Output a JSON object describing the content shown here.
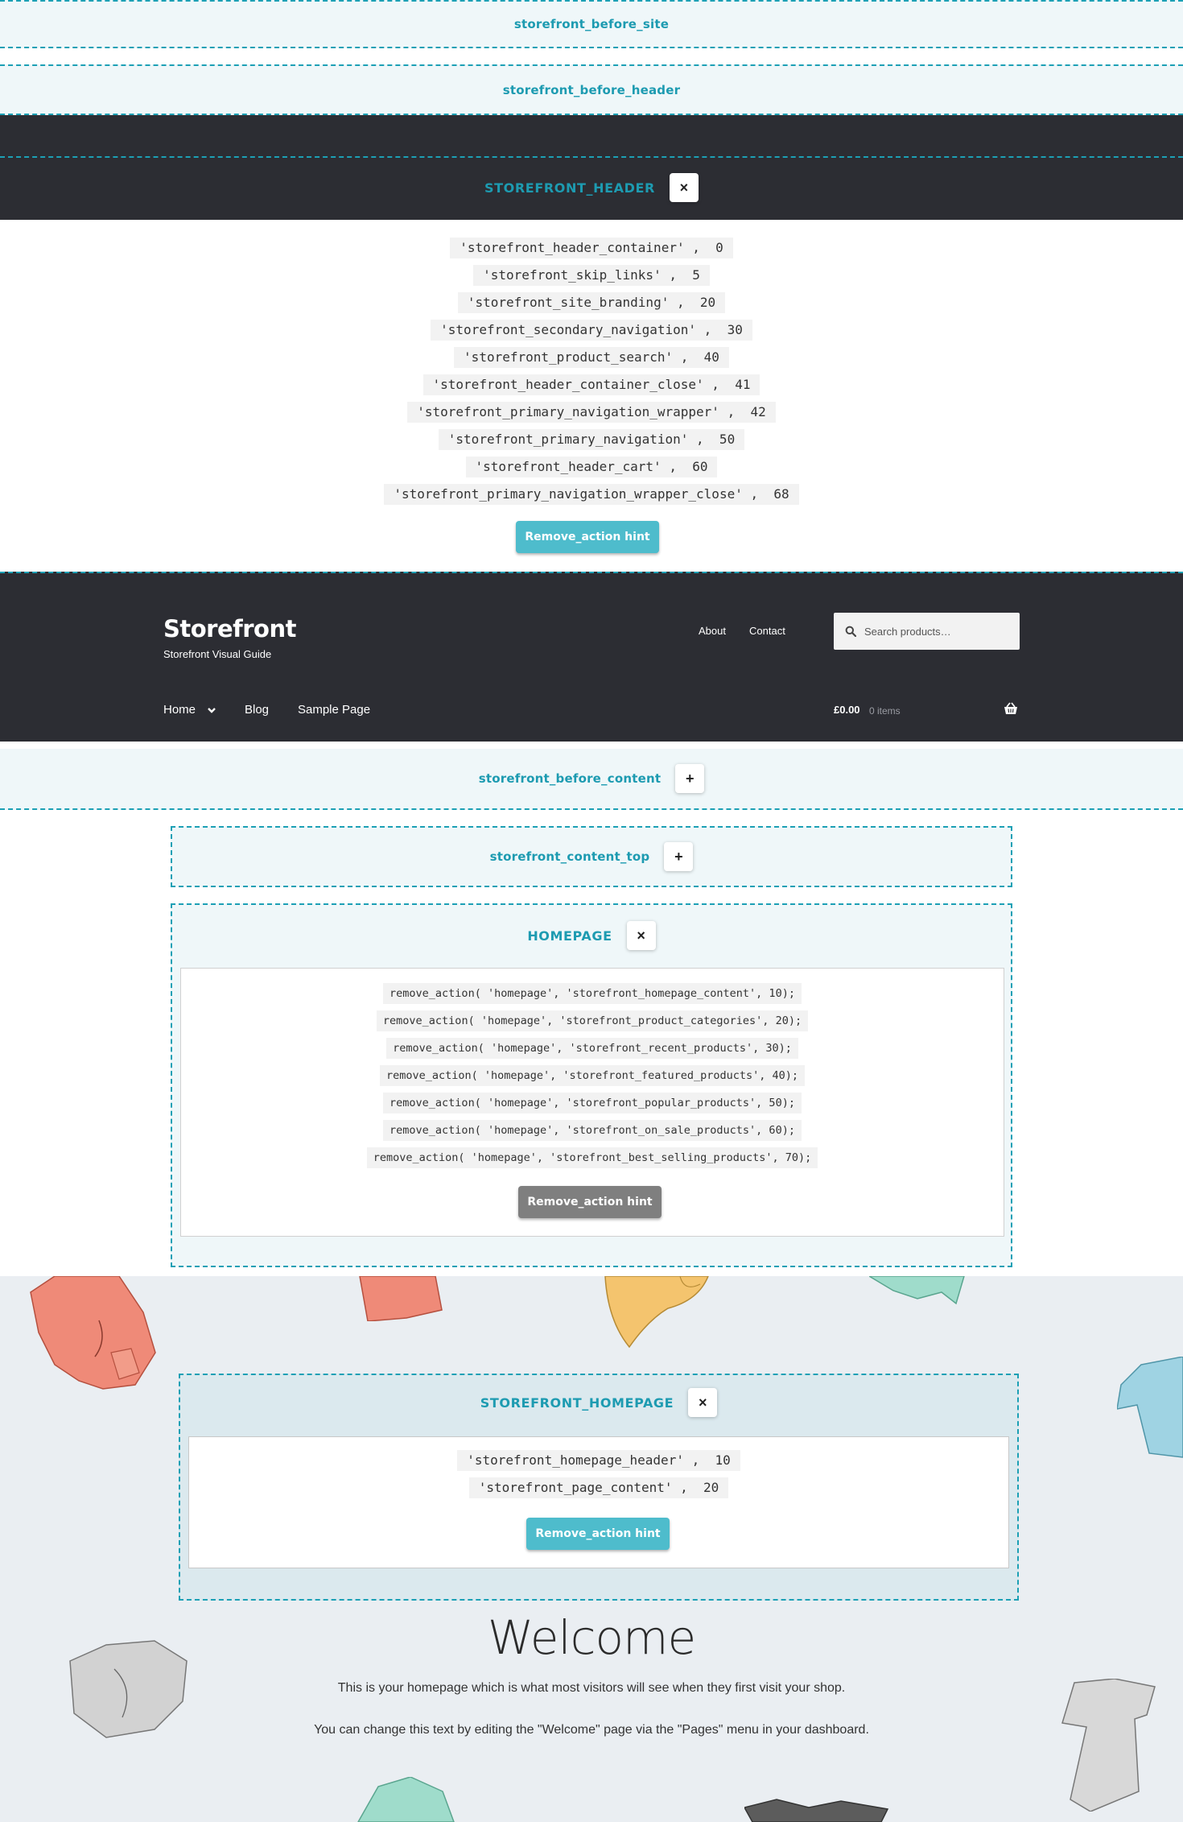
{
  "hooks": {
    "before_site": "storefront_before_site",
    "before_header": "storefront_before_header",
    "header": "STOREFRONT_HEADER",
    "before_content": "storefront_before_content",
    "content_top": "storefront_content_top",
    "homepage": "HOMEPAGE",
    "storefront_homepage": "STOREFRONT_HOMEPAGE"
  },
  "toggles": {
    "close": "×",
    "open": "+"
  },
  "header_actions": [
    "'storefront_header_container' ,  0",
    "'storefront_skip_links' ,  5",
    "'storefront_site_branding' ,  20",
    "'storefront_secondary_navigation' ,  30",
    "'storefront_product_search' ,  40",
    "'storefront_header_container_close' ,  41",
    "'storefront_primary_navigation_wrapper' ,  42",
    "'storefront_primary_navigation' ,  50",
    "'storefront_header_cart' ,  60",
    "'storefront_primary_navigation_wrapper_close' ,  68"
  ],
  "remove_hint_label": "Remove_action hint",
  "site": {
    "title": "Storefront",
    "tagline": "Storefront Visual Guide",
    "secondary_nav": [
      "About",
      "Contact"
    ],
    "search_placeholder": "Search products…",
    "primary_nav": [
      "Home",
      "Blog",
      "Sample Page"
    ],
    "cart_amount": "£0.00",
    "cart_items": "0 items"
  },
  "homepage_actions": [
    "remove_action( 'homepage', 'storefront_homepage_content', 10);",
    "remove_action( 'homepage', 'storefront_product_categories', 20);",
    "remove_action( 'homepage', 'storefront_recent_products', 30);",
    "remove_action( 'homepage', 'storefront_featured_products', 40);",
    "remove_action( 'homepage', 'storefront_popular_products', 50);",
    "remove_action( 'homepage', 'storefront_on_sale_products', 60);",
    "remove_action( 'homepage', 'storefront_best_selling_products', 70);"
  ],
  "storefront_homepage_actions": [
    "'storefront_homepage_header' ,  10",
    "'storefront_page_content' ,  20"
  ],
  "welcome": {
    "title": "Welcome",
    "line1": "This is your homepage which is what most visitors will see when they first visit your shop.",
    "line2": "You can change this text by editing the \"Welcome\" page via the \"Pages\" menu in your dashboard."
  },
  "colors": {
    "accent": "#1ca0b5",
    "dark": "#2c2d33",
    "button_teal": "#4ebccc",
    "button_grey": "#7f7f7f"
  }
}
